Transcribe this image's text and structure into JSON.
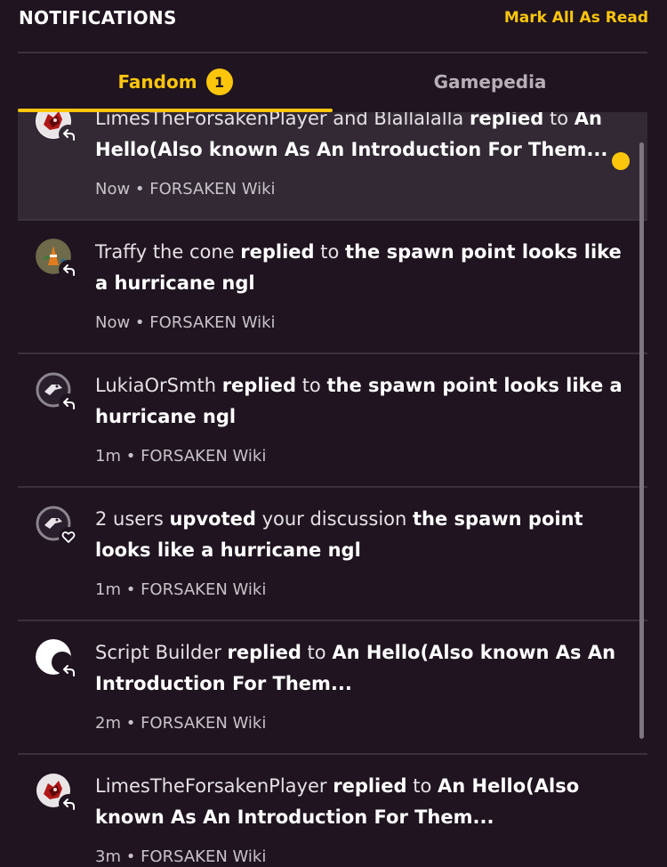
{
  "header": {
    "title": "NOTIFICATIONS",
    "mark_all_label": "Mark All As Read"
  },
  "tabs": [
    {
      "label": "Fandom",
      "badge": "1",
      "active": true
    },
    {
      "label": "Gamepedia",
      "active": false
    }
  ],
  "colors": {
    "accent": "#fcc60c",
    "background": "#1f1420",
    "unread_background": "#322934",
    "divider": "#3a313b"
  },
  "notifications": [
    {
      "avatar": "user-avatar-red-creature",
      "type_icon": "reply-icon",
      "actor": "LimesTheForsakenPlayer and Blallalalla",
      "action": "replied",
      "connector": "to",
      "target": "An Hello(Also known As An Introduction For Them...",
      "time": "Now",
      "wiki": "FORSAKEN Wiki",
      "unread": true
    },
    {
      "avatar": "user-avatar-cone",
      "type_icon": "reply-icon",
      "actor": "Traffy the cone",
      "action": "replied",
      "connector": "to",
      "target": "the spawn point looks like a hurricane ngl",
      "time": "Now",
      "wiki": "FORSAKEN Wiki",
      "unread": false
    },
    {
      "avatar": "user-avatar-grey-bird",
      "type_icon": "reply-icon",
      "actor": "LukiaOrSmth",
      "action": "replied",
      "connector": "to",
      "target": "the spawn point looks like a hurricane ngl",
      "time": "1m",
      "wiki": "FORSAKEN Wiki",
      "unread": false
    },
    {
      "avatar": "user-avatar-grey-bird",
      "type_icon": "heart-icon",
      "actor": "2 users",
      "action": "upvoted",
      "connector": "your discussion",
      "target": "the spawn point looks like a hurricane ngl",
      "time": "1m",
      "wiki": "FORSAKEN Wiki",
      "unread": false
    },
    {
      "avatar": "user-avatar-white-moon",
      "type_icon": "reply-icon",
      "actor": "Script Builder",
      "action": "replied",
      "connector": "to",
      "target": "An Hello(Also known As An Introduction For Them...",
      "time": "2m",
      "wiki": "FORSAKEN Wiki",
      "unread": false
    },
    {
      "avatar": "user-avatar-red-creature",
      "type_icon": "reply-icon",
      "actor": "LimesTheForsakenPlayer",
      "action": "replied",
      "connector": "to",
      "target": "An Hello(Also known As An Introduction For Them...",
      "time": "3m",
      "wiki": "FORSAKEN Wiki",
      "unread": false
    }
  ]
}
